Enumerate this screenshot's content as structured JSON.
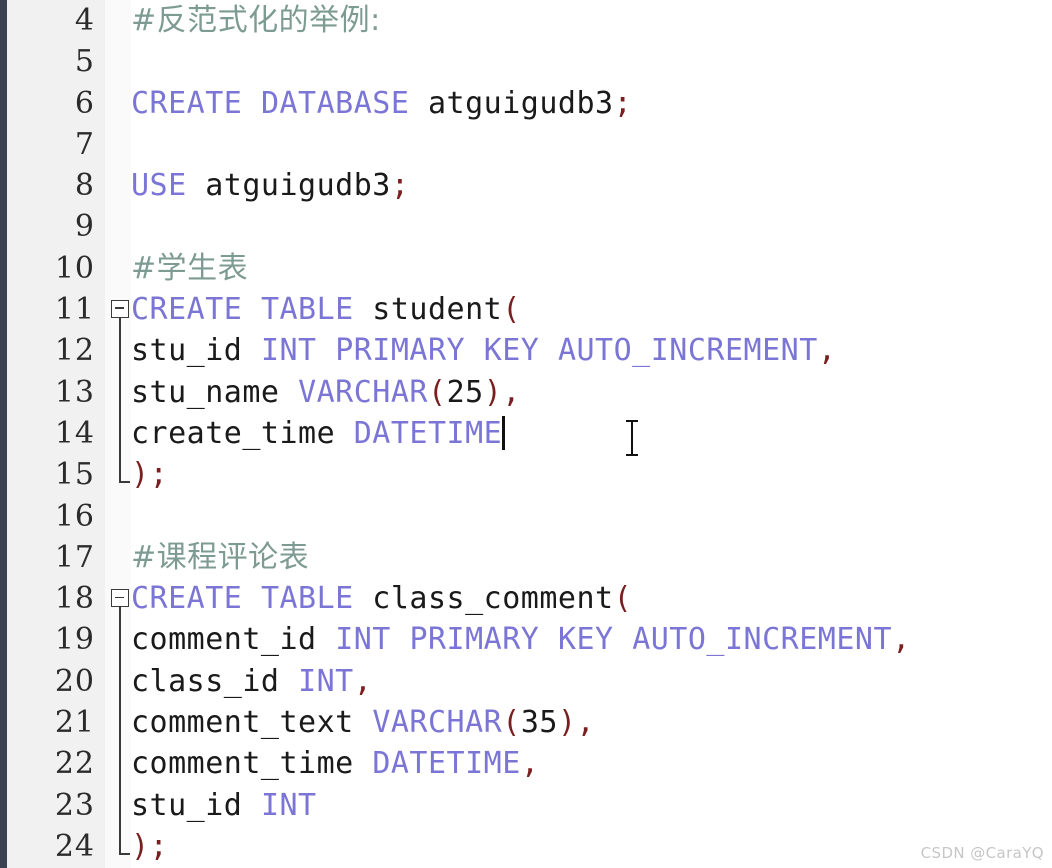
{
  "editor": {
    "title": "SQL code editor",
    "language": "SQL",
    "first_visible_line": 4,
    "last_visible_line": 24,
    "colors": {
      "background": "#ffffff",
      "gutter_background": "#f1f1f1",
      "edge_bar": "#3b4252",
      "keyword": "#7b76d6",
      "identifier": "#1a1a1a",
      "comment": "#7d9b92",
      "punctuation": "#7a1f1f",
      "line_number": "#2b2b2b",
      "fold_marker": "#3a3a3a",
      "watermark": "#c6c6c6"
    }
  },
  "lines": [
    {
      "number": "4",
      "fold": "none",
      "tokens": [
        {
          "text": "#反范式化的举例:",
          "type": "cmt"
        }
      ]
    },
    {
      "number": "5",
      "fold": "none",
      "tokens": []
    },
    {
      "number": "6",
      "fold": "none",
      "tokens": [
        {
          "text": "CREATE",
          "type": "kw"
        },
        {
          "text": " ",
          "type": "id"
        },
        {
          "text": "DATABASE",
          "type": "kw"
        },
        {
          "text": " atguigudb3",
          "type": "id"
        },
        {
          "text": ";",
          "type": "punc"
        }
      ]
    },
    {
      "number": "7",
      "fold": "none",
      "tokens": []
    },
    {
      "number": "8",
      "fold": "none",
      "tokens": [
        {
          "text": "USE",
          "type": "kw"
        },
        {
          "text": " atguigudb3",
          "type": "id"
        },
        {
          "text": ";",
          "type": "punc"
        }
      ]
    },
    {
      "number": "9",
      "fold": "none",
      "tokens": []
    },
    {
      "number": "10",
      "fold": "none",
      "tokens": [
        {
          "text": "#学生表",
          "type": "cmt"
        }
      ]
    },
    {
      "number": "11",
      "fold": "start",
      "tokens": [
        {
          "text": "CREATE",
          "type": "kw"
        },
        {
          "text": " ",
          "type": "id"
        },
        {
          "text": "TABLE",
          "type": "kw"
        },
        {
          "text": " student",
          "type": "id"
        },
        {
          "text": "(",
          "type": "punc"
        }
      ]
    },
    {
      "number": "12",
      "fold": "body",
      "tokens": [
        {
          "text": "stu_id ",
          "type": "id"
        },
        {
          "text": "INT",
          "type": "kw"
        },
        {
          "text": " ",
          "type": "id"
        },
        {
          "text": "PRIMARY",
          "type": "kw"
        },
        {
          "text": " ",
          "type": "id"
        },
        {
          "text": "KEY",
          "type": "kw"
        },
        {
          "text": " ",
          "type": "id"
        },
        {
          "text": "AUTO_INCREMENT",
          "type": "kw"
        },
        {
          "text": ",",
          "type": "punc"
        }
      ]
    },
    {
      "number": "13",
      "fold": "body",
      "tokens": [
        {
          "text": "stu_name ",
          "type": "id"
        },
        {
          "text": "VARCHAR",
          "type": "kw"
        },
        {
          "text": "(",
          "type": "punc"
        },
        {
          "text": "25",
          "type": "num"
        },
        {
          "text": ")",
          "type": "punc"
        },
        {
          "text": ",",
          "type": "punc"
        }
      ]
    },
    {
      "number": "14",
      "fold": "body",
      "tokens": [
        {
          "text": "create_time ",
          "type": "id"
        },
        {
          "text": "DATETIME",
          "type": "kw"
        }
      ],
      "caret_after": true
    },
    {
      "number": "15",
      "fold": "end",
      "tokens": [
        {
          "text": ")",
          "type": "punc"
        },
        {
          "text": ";",
          "type": "punc"
        }
      ]
    },
    {
      "number": "16",
      "fold": "none",
      "tokens": []
    },
    {
      "number": "17",
      "fold": "none",
      "tokens": [
        {
          "text": "#课程评论表",
          "type": "cmt"
        }
      ]
    },
    {
      "number": "18",
      "fold": "start",
      "tokens": [
        {
          "text": "CREATE",
          "type": "kw"
        },
        {
          "text": " ",
          "type": "id"
        },
        {
          "text": "TABLE",
          "type": "kw"
        },
        {
          "text": " class_comment",
          "type": "id"
        },
        {
          "text": "(",
          "type": "punc"
        }
      ]
    },
    {
      "number": "19",
      "fold": "body",
      "tokens": [
        {
          "text": "comment_id ",
          "type": "id"
        },
        {
          "text": "INT",
          "type": "kw"
        },
        {
          "text": " ",
          "type": "id"
        },
        {
          "text": "PRIMARY",
          "type": "kw"
        },
        {
          "text": " ",
          "type": "id"
        },
        {
          "text": "KEY",
          "type": "kw"
        },
        {
          "text": " ",
          "type": "id"
        },
        {
          "text": "AUTO_INCREMENT",
          "type": "kw"
        },
        {
          "text": ",",
          "type": "punc"
        }
      ]
    },
    {
      "number": "20",
      "fold": "body",
      "tokens": [
        {
          "text": "class_id ",
          "type": "id"
        },
        {
          "text": "INT",
          "type": "kw"
        },
        {
          "text": ",",
          "type": "punc"
        }
      ]
    },
    {
      "number": "21",
      "fold": "body",
      "tokens": [
        {
          "text": "comment_text ",
          "type": "id"
        },
        {
          "text": "VARCHAR",
          "type": "kw"
        },
        {
          "text": "(",
          "type": "punc"
        },
        {
          "text": "35",
          "type": "num"
        },
        {
          "text": ")",
          "type": "punc"
        },
        {
          "text": ",",
          "type": "punc"
        }
      ]
    },
    {
      "number": "22",
      "fold": "body",
      "tokens": [
        {
          "text": "comment_time ",
          "type": "id"
        },
        {
          "text": "DATETIME",
          "type": "kw"
        },
        {
          "text": ",",
          "type": "punc"
        }
      ]
    },
    {
      "number": "23",
      "fold": "body",
      "tokens": [
        {
          "text": "stu_id ",
          "type": "id"
        },
        {
          "text": "INT",
          "type": "kw"
        }
      ]
    },
    {
      "number": "24",
      "fold": "end",
      "tokens": [
        {
          "text": ")",
          "type": "punc"
        },
        {
          "text": ";",
          "type": "punc"
        }
      ]
    }
  ],
  "cursor": {
    "mouse_pointer": "i-beam-cursor",
    "text_caret_line": "14"
  },
  "watermark": {
    "text": "CSDN @CaraYQ"
  }
}
